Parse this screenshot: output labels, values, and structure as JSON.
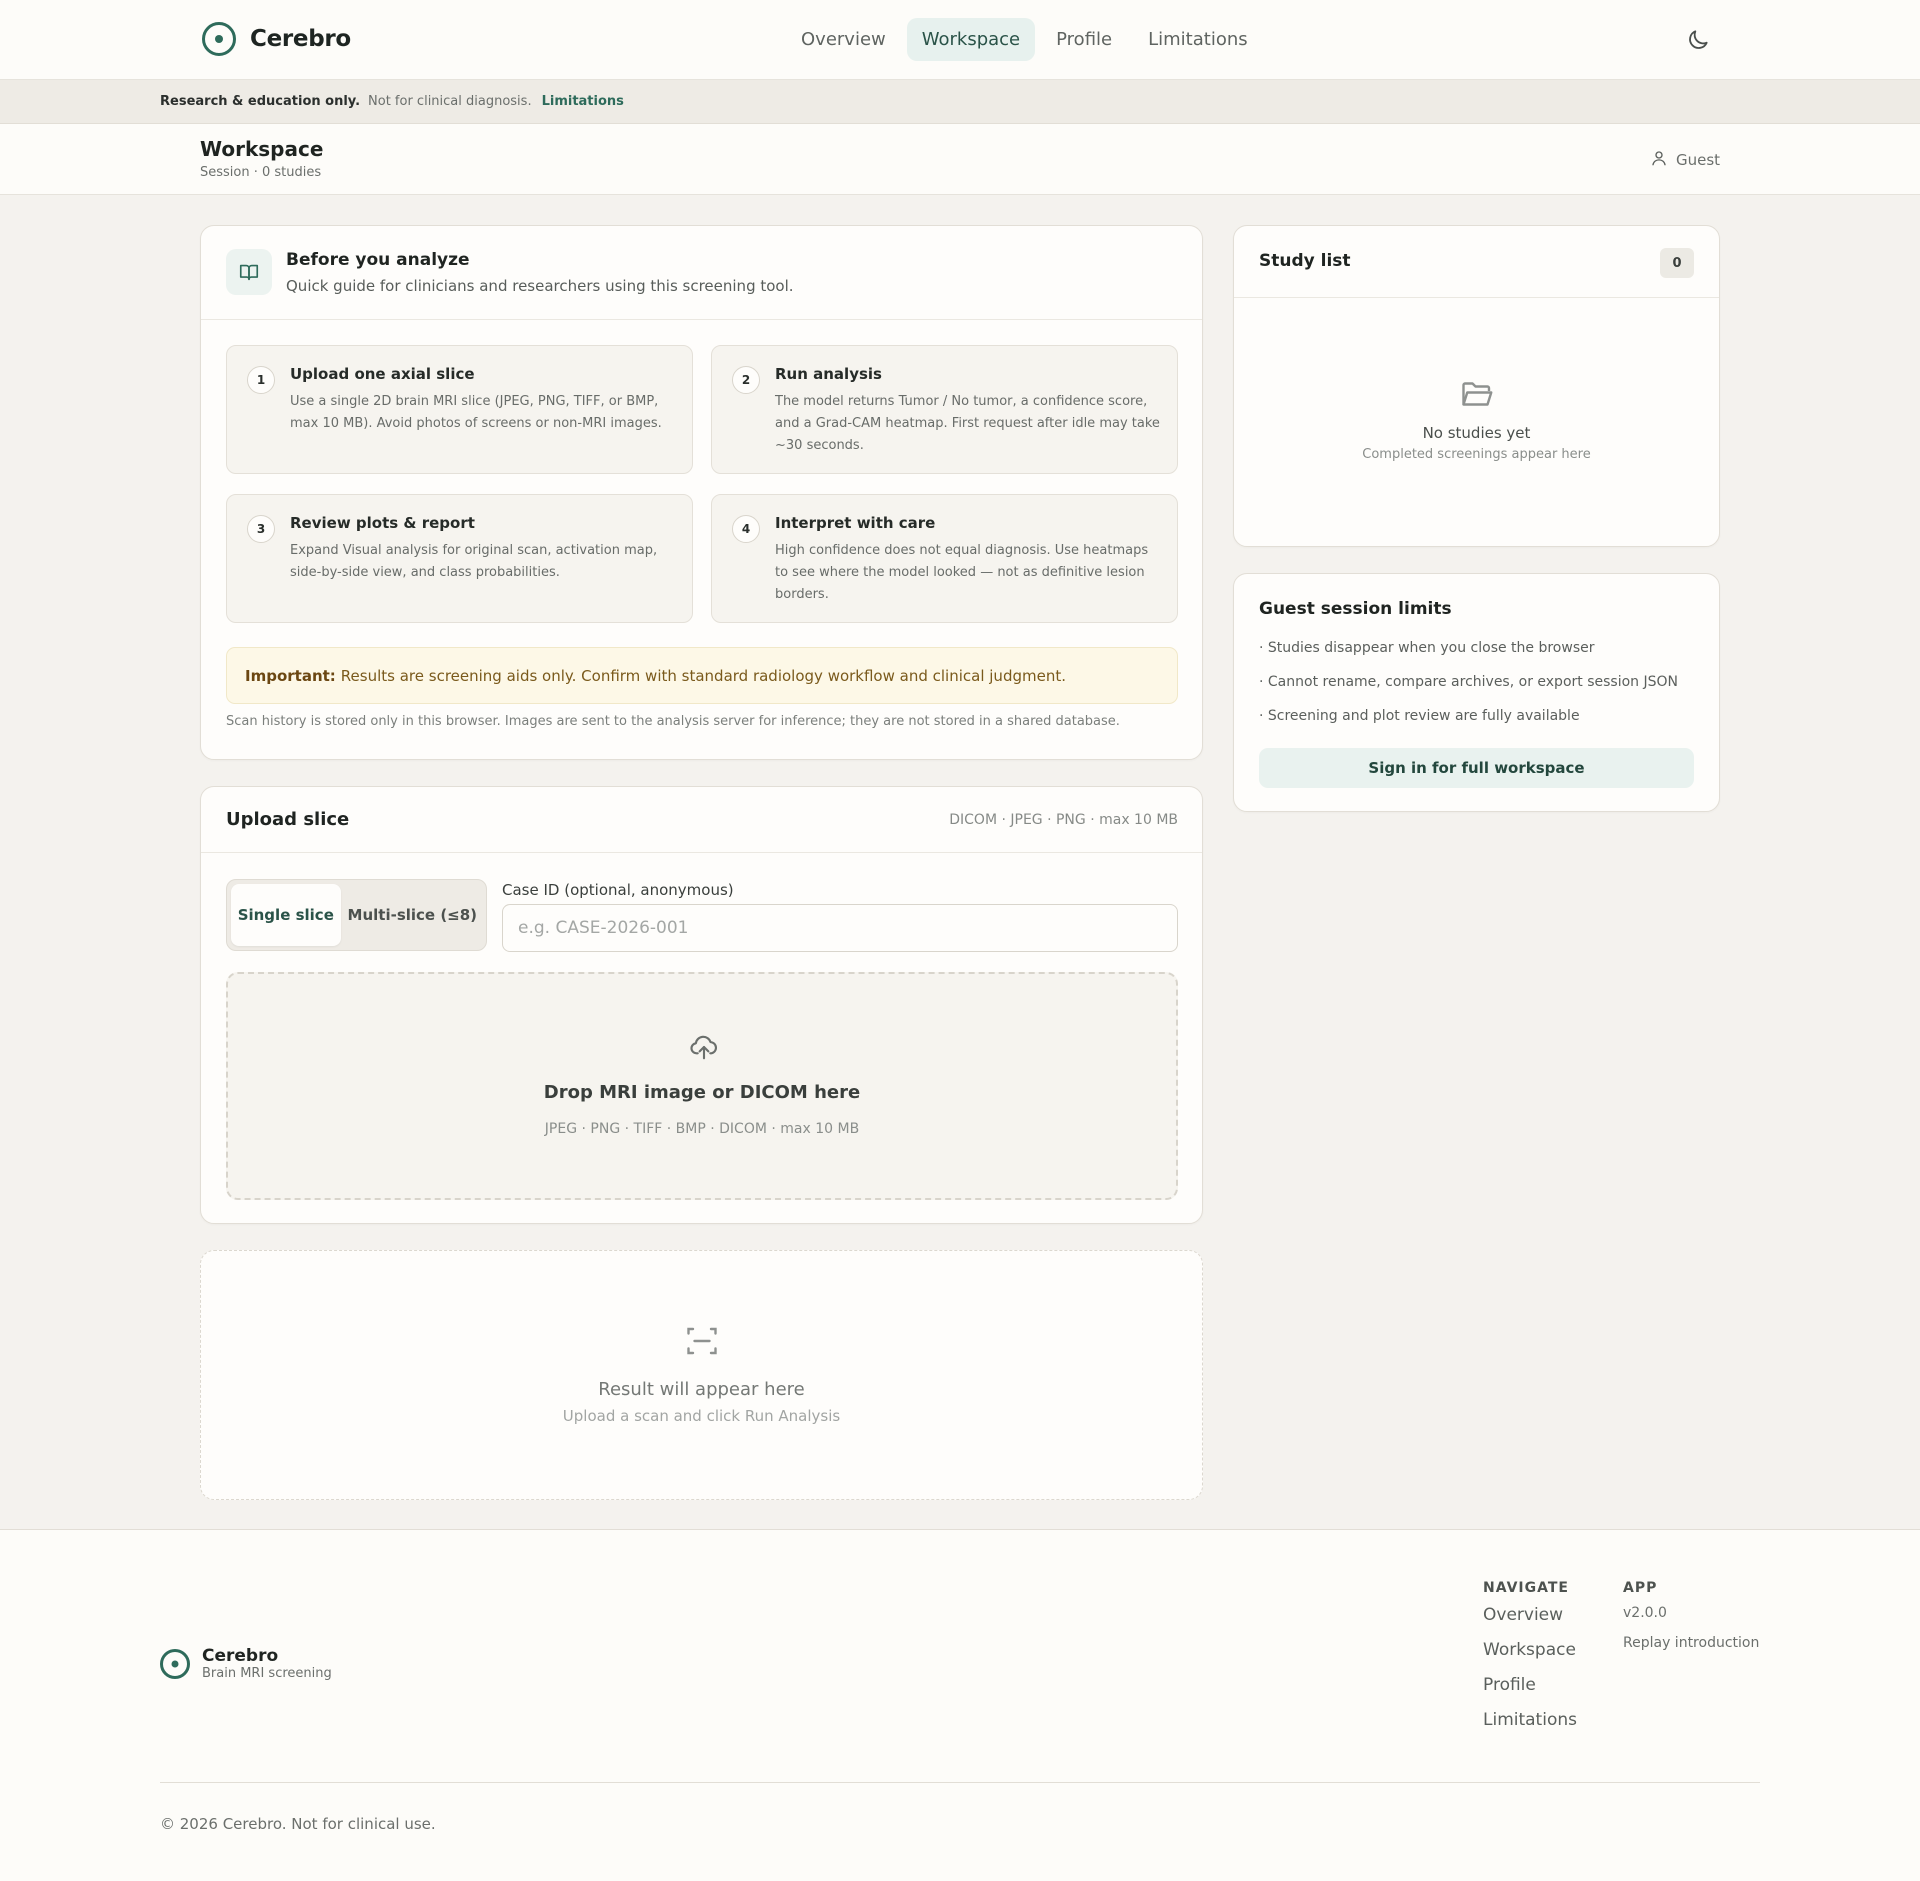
{
  "app": {
    "name": "Cerebro"
  },
  "nav": {
    "links": [
      {
        "label": "Overview",
        "active": false
      },
      {
        "label": "Workspace",
        "active": true
      },
      {
        "label": "Profile",
        "active": false
      },
      {
        "label": "Limitations",
        "active": false
      }
    ],
    "theme_toggle_icon": "moon-icon"
  },
  "notice": {
    "bold": "Research & education only.",
    "text": "Not for clinical diagnosis.",
    "link": "Limitations"
  },
  "header": {
    "title": "Workspace",
    "subtitle": "Session · 0 studies",
    "user": "Guest"
  },
  "guide": {
    "title": "Before you analyze",
    "subtitle": "Quick guide for clinicians and researchers using this screening tool.",
    "steps": [
      {
        "num": "1",
        "title": "Upload one axial slice",
        "body": "Use a single 2D brain MRI slice (JPEG, PNG, TIFF, or BMP, max 10 MB). Avoid photos of screens or non-MRI images."
      },
      {
        "num": "2",
        "title": "Run analysis",
        "body": "The model returns Tumor / No tumor, a confidence score, and a Grad-CAM heatmap. First request after idle may take ~30 seconds."
      },
      {
        "num": "3",
        "title": "Review plots & report",
        "body": "Expand Visual analysis for original scan, activation map, side-by-side view, and class probabilities."
      },
      {
        "num": "4",
        "title": "Interpret with care",
        "body": "High confidence does not equal diagnosis. Use heatmaps to see where the model looked — not as definitive lesion borders."
      }
    ],
    "important_label": "Important:",
    "important_text": "Results are screening aids only. Confirm with standard radiology workflow and clinical judgment.",
    "footnote": "Scan history is stored only in this browser. Images are sent to the analysis server for inference; they are not stored in a shared database."
  },
  "upload": {
    "title": "Upload slice",
    "formats": "DICOM · JPEG · PNG · max 10 MB",
    "modes": [
      "Single slice",
      "Multi-slice (≤8)"
    ],
    "case_label": "Case ID (optional, anonymous)",
    "case_placeholder": "e.g. CASE-2026-001",
    "case_value": "",
    "drop_title": "Drop MRI image or DICOM here",
    "drop_sub": "JPEG · PNG · TIFF · BMP · DICOM · max 10 MB"
  },
  "result": {
    "title": "Result will appear here",
    "subtitle": "Upload a scan and click Run Analysis"
  },
  "study_list": {
    "title": "Study list",
    "count": "0",
    "empty_title": "No studies yet",
    "empty_sub": "Completed screenings appear here"
  },
  "limits": {
    "title": "Guest session limits",
    "items": [
      "· Studies disappear when you close the browser",
      "· Cannot rename, compare archives, or export session JSON",
      "· Screening and plot review are fully available"
    ],
    "button": "Sign in for full workspace"
  },
  "footer": {
    "brand": "Cerebro",
    "tagline": "Brain MRI screening",
    "navigate_heading": "NAVIGATE",
    "navigate_links": [
      "Overview",
      "Workspace",
      "Profile",
      "Limitations"
    ],
    "app_heading": "APP",
    "version": "v2.0.0",
    "replay": "Replay introduction",
    "copyright": "© 2026 Cerebro. Not for clinical use."
  },
  "colors": {
    "accent": "#2e6b5b",
    "background": "#f4f2ee",
    "card": "#fefdfb",
    "important_bg": "#fdf8e7"
  }
}
